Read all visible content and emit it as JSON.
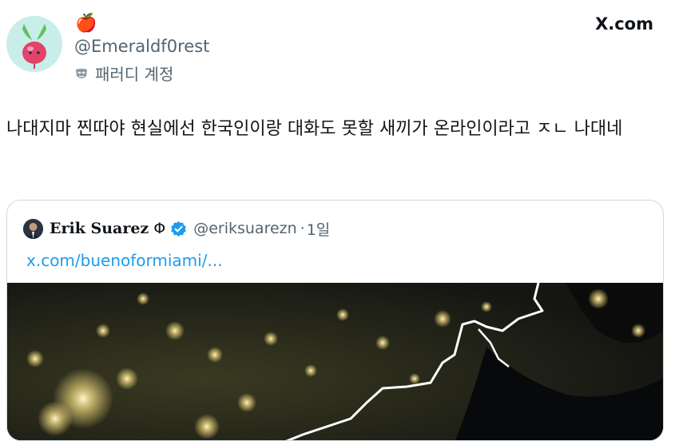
{
  "author": {
    "emoji": "🍎",
    "handle": "@Emeraldf0rest",
    "parody_label": "패러디 계정"
  },
  "brand": {
    "label": "X.com"
  },
  "tweet": {
    "text": "나대지마 찐따야 현실에선 한국인이랑 대화도 못할 새끼가 온라인이라고 ㅈㄴ 나대네"
  },
  "quoted_tweet": {
    "name": "Erik Suarez",
    "name_suffix": "Φ",
    "handle": "@eriksuarezn",
    "separator": "·",
    "time": "1일",
    "link": "x.com/buenoformiami/..."
  },
  "colors": {
    "link": "#1d9bf0",
    "secondary_text": "#536471",
    "verified_badge": "#1d9bf0",
    "card_border": "#cfd9de"
  },
  "icons": {
    "verified": "verified-badge-icon",
    "parody": "mask-icon",
    "avatar": "radish-avatar"
  }
}
